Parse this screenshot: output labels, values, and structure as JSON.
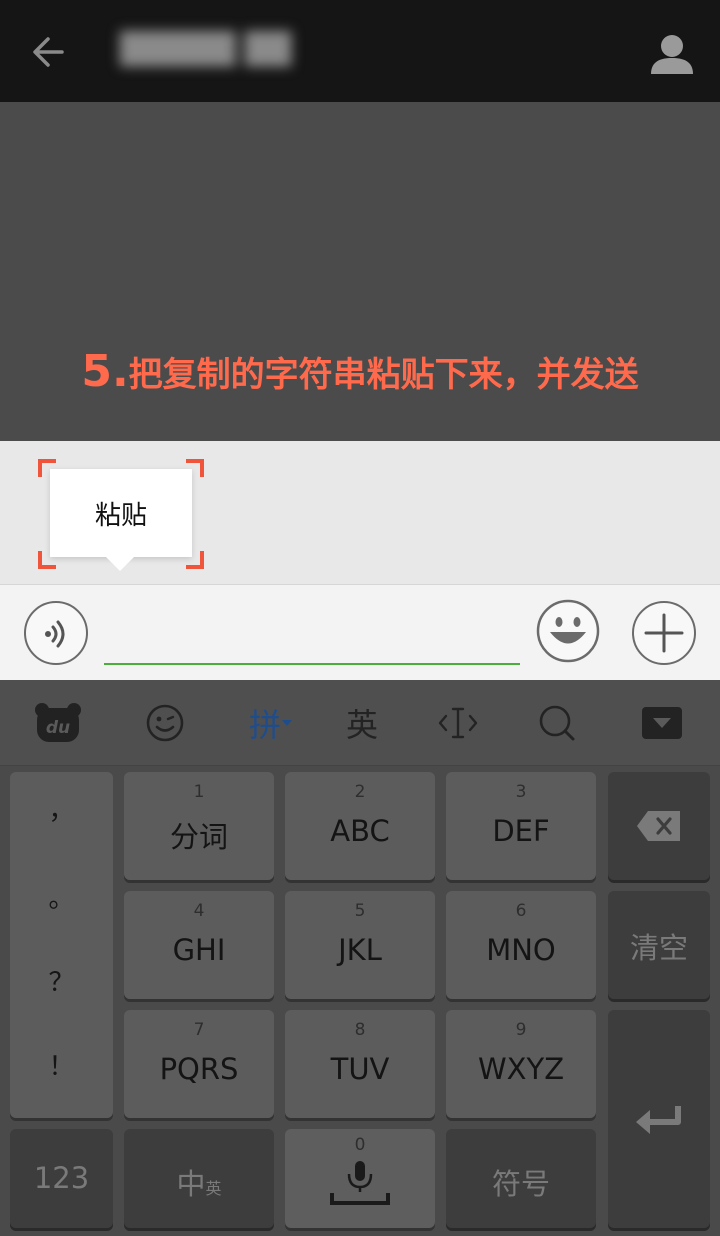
{
  "header": {
    "title": "█████ ██",
    "back_icon": "arrow-left-icon",
    "profile_icon": "person-icon"
  },
  "chat": {
    "instruction_number": "5.",
    "instruction_text": "把复制的字符串粘贴下来，并发送"
  },
  "paste_menu": {
    "label": "粘贴"
  },
  "input_bar": {
    "value": "",
    "voice_icon": "voice-icon",
    "emoji_icon": "emoji-icon",
    "plus_icon": "plus-icon",
    "accent_color": "#4cae3a"
  },
  "keyboard": {
    "toolbar": {
      "logo_icon": "baidu-logo-icon",
      "logo_text": "du",
      "emoji_icon": "emoji-icon",
      "pinyin": "拼",
      "english": "英",
      "cursor_icon": "cursor-icon",
      "search_icon": "search-icon",
      "collapse_icon": "collapse-keyboard-icon"
    },
    "punctuation": [
      "，",
      "。",
      "？",
      "！"
    ],
    "keys": [
      {
        "num": "1",
        "label": "分词"
      },
      {
        "num": "2",
        "label": "ABC"
      },
      {
        "num": "3",
        "label": "DEF"
      },
      {
        "num": "4",
        "label": "GHI"
      },
      {
        "num": "5",
        "label": "JKL"
      },
      {
        "num": "6",
        "label": "MNO"
      },
      {
        "num": "7",
        "label": "PQRS"
      },
      {
        "num": "8",
        "label": "TUV"
      },
      {
        "num": "9",
        "label": "WXYZ"
      }
    ],
    "backspace_icon": "backspace-icon",
    "clear": "清空",
    "enter_icon": "enter-icon",
    "num_key": "123",
    "lang_key": "中",
    "lang_key_sub": "英",
    "zero_num": "0",
    "mic_icon": "mic-icon",
    "symbol_key": "符号"
  }
}
